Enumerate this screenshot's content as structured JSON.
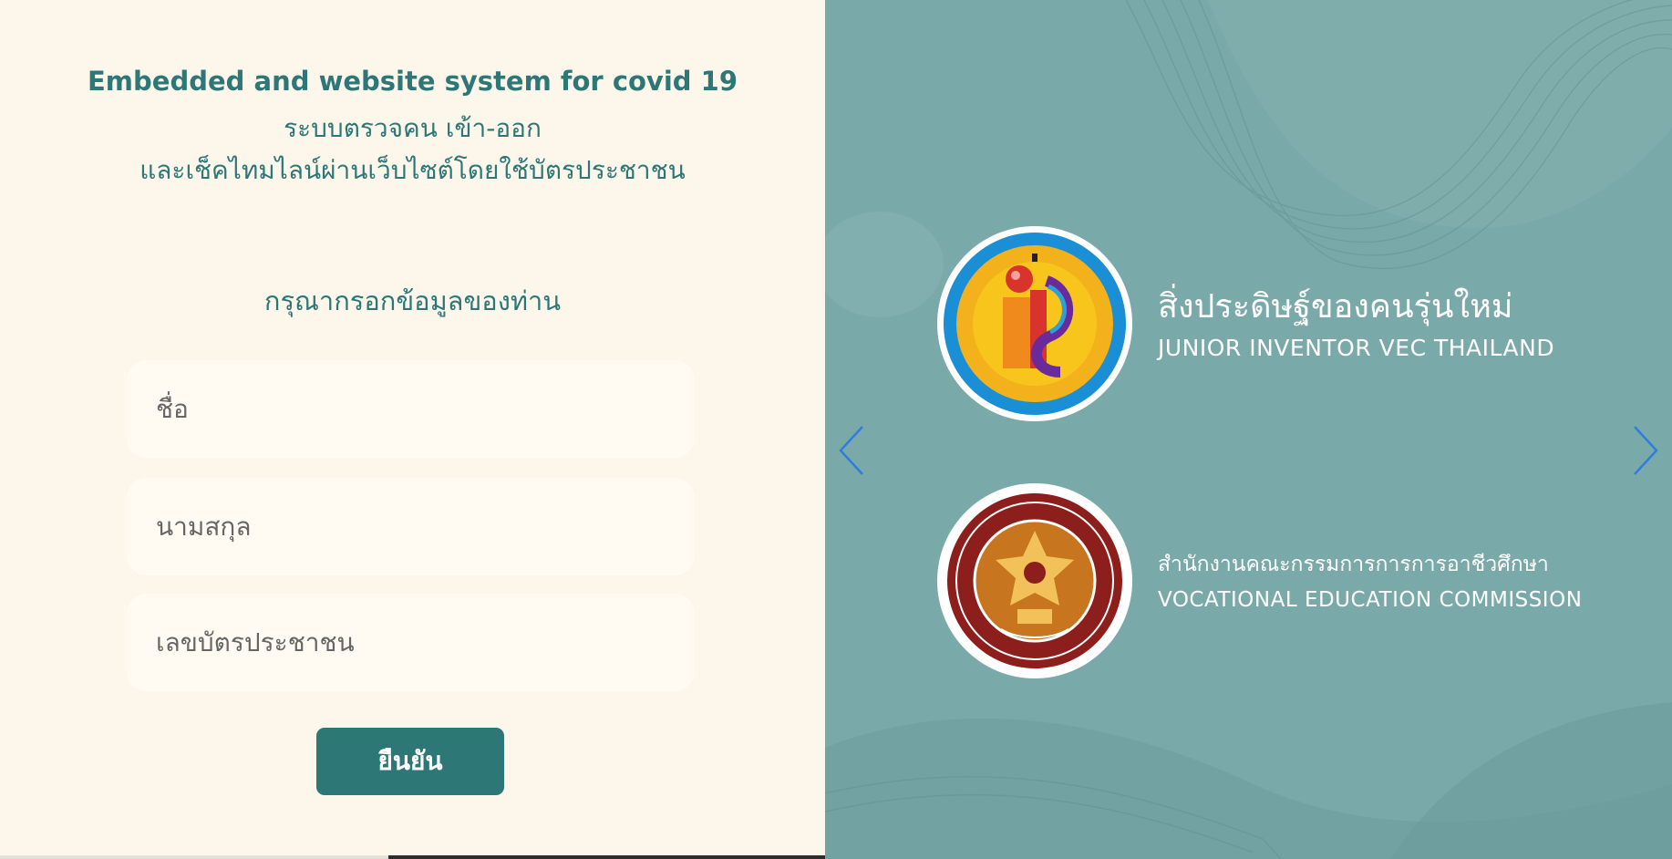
{
  "form": {
    "title_en": "Embedded and website system for covid 19",
    "title_th_line1": "ระบบตรวจคน เข้า-ออก",
    "title_th_line2": "และเช็คไทมไลน์ผ่านเว็บไซต์โดยใช้บัตรประชาชน",
    "prompt": "กรุณากรอกข้อมูลของท่าน",
    "first_name_placeholder": "ชื่อ",
    "last_name_placeholder": "นามสกุล",
    "id_card_placeholder": "เลขบัตรประชาชน",
    "submit_label": "ยืนยัน"
  },
  "carousel": {
    "slide1_title_th": "สิ่งประดิษฐ์ของคนรุ่นใหม่",
    "slide1_title_en": "JUNIOR INVENTOR VEC THAILAND",
    "slide2_title_th": "สำนักงานคณะกรรมการการการอาชีวศึกษา",
    "slide2_title_en": "VOCATIONAL EDUCATION COMMISSION",
    "logo1_ring_text": "JUNIOR INVENTOR VEC THAILAND",
    "logo2_ring_text": "VOCATIONAL EDUCATION COMMISSION",
    "prev_icon": "chevron-left-icon",
    "next_icon": "chevron-right-icon"
  },
  "colors": {
    "brand": "#2d7877",
    "panel_bg": "#7aa8a8",
    "form_bg": "#fdf6ea",
    "arrow": "#2f7de1"
  }
}
